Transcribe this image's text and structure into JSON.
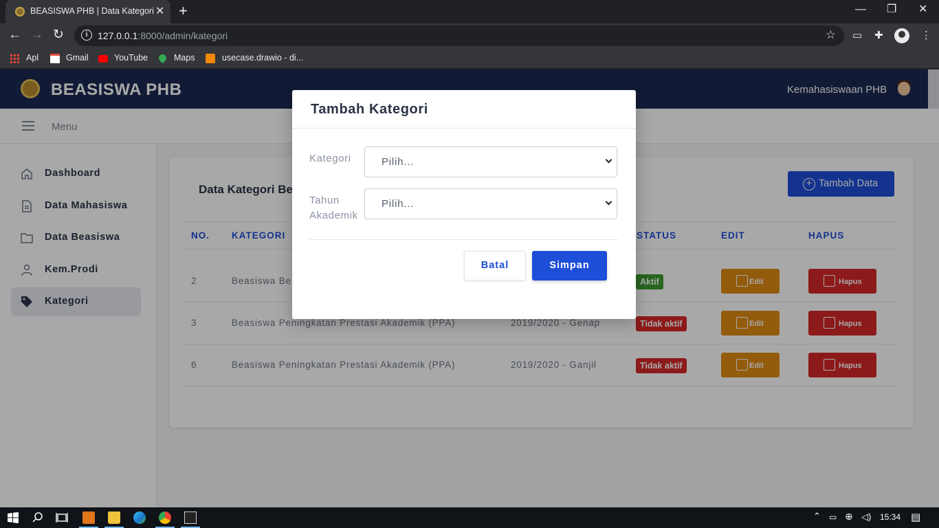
{
  "browser": {
    "tab_title": "BEASISWA PHB | Data Kategori",
    "url_host": "127.0.0.1",
    "url_rest": ":8000/admin/kategori",
    "bookmarks": [
      {
        "label": "Apl",
        "icon": "apps-grid-icon"
      },
      {
        "label": "Gmail",
        "icon": "gmail-icon"
      },
      {
        "label": "YouTube",
        "icon": "youtube-icon"
      },
      {
        "label": "Maps",
        "icon": "maps-icon"
      },
      {
        "label": "usecase.drawio - di...",
        "icon": "drawio-icon"
      }
    ]
  },
  "header": {
    "brand": "BEASISWA PHB",
    "user": "Kemahasiswaan PHB"
  },
  "menubar": {
    "label": "Menu"
  },
  "sidebar": {
    "items": [
      {
        "label": "Dashboard",
        "icon": "home-icon"
      },
      {
        "label": "Data Mahasiswa",
        "icon": "document-icon"
      },
      {
        "label": "Data Beasiswa",
        "icon": "folder-icon"
      },
      {
        "label": "Kem.Prodi",
        "icon": "user-icon"
      },
      {
        "label": "Kategori",
        "icon": "tag-icon",
        "active": true
      }
    ]
  },
  "card": {
    "title": "Data Kategori Be",
    "add_button": "Tambah Data",
    "columns": [
      "NO.",
      "KATEGORI",
      "STATUS",
      "EDIT",
      "HAPUS"
    ],
    "rows": [
      {
        "no": "2",
        "kategori": "Beasiswa Be",
        "tahun": "",
        "status": "Aktif",
        "status_color": "#3d9a2f",
        "edit": "Edit",
        "hapus": "Hapus"
      },
      {
        "no": "3",
        "kategori": "Beasiswa Peningkatan Prestasi Akademik (PPA)",
        "tahun": "2019/2020 - Genap",
        "status": "Tidak aktif",
        "status_color": "#d62828",
        "edit": "Edit",
        "hapus": "Hapus"
      },
      {
        "no": "6",
        "kategori": "Beasiswa Peningkatan Prestasi Akademik (PPA)",
        "tahun": "2019/2020 - Ganjil",
        "status": "Tidak aktif",
        "status_color": "#d62828",
        "edit": "Edit",
        "hapus": "Hapus"
      }
    ]
  },
  "modal": {
    "title": "Tambah Kategori",
    "kategori_label": "Kategori",
    "kategori_value": "Pilih...",
    "tahun_label_1": "Tahun",
    "tahun_label_2": "Akademik",
    "tahun_value": "Pilih...",
    "cancel": "Batal",
    "save": "Simpan"
  },
  "taskbar": {
    "time": "15:34"
  },
  "colors": {
    "primary": "#1d4ed8",
    "header_bg": "#1c2a52",
    "edit": "#e08a13",
    "danger": "#d62828",
    "success": "#3d9a2f"
  }
}
